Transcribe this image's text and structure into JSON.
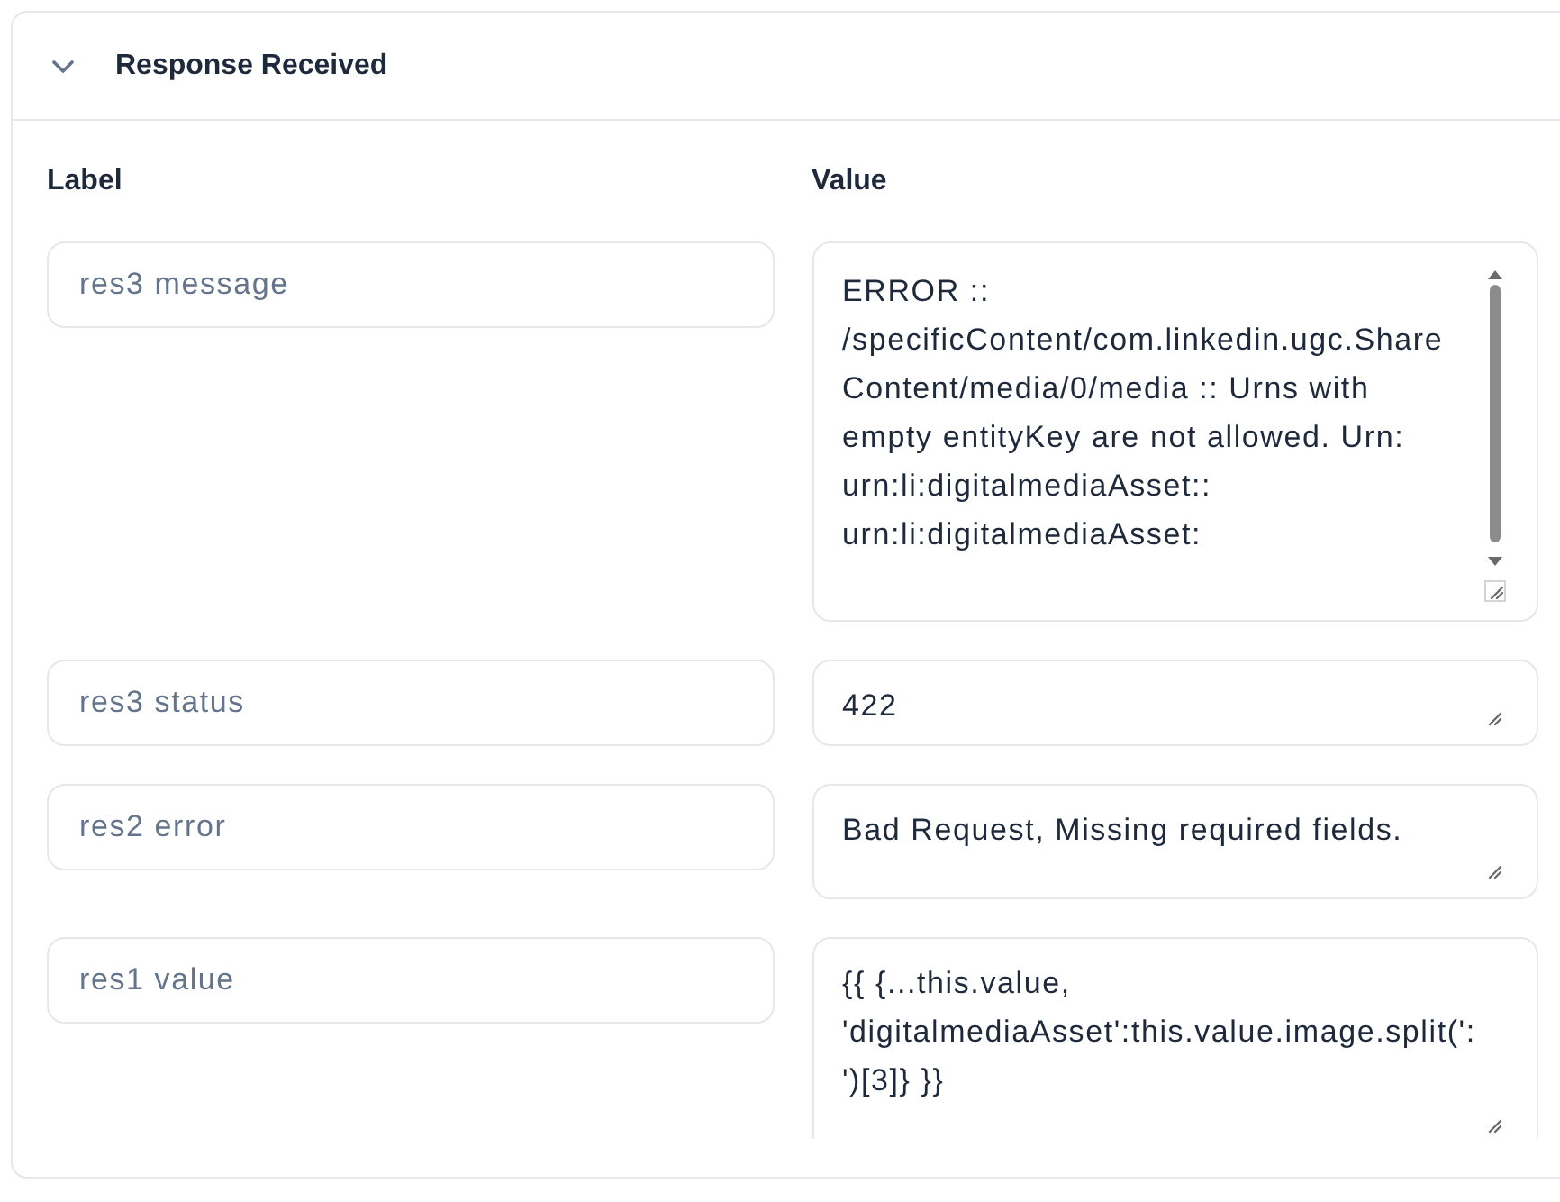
{
  "panel": {
    "title": "Response Received",
    "expanded": true,
    "columns": [
      "Label",
      "Value"
    ],
    "rows": [
      {
        "label_field": {
          "placeholder": "res3 message"
        },
        "value_field": {
          "value": "ERROR :: /specificContent/com.linkedin.ugc.ShareContent/media/0/media :: Urns with empty entityKey are not allowed. Urn: urn:li:digitalmediaAsset:: urn:li:digitalmediaAsset:",
          "scrollable": true
        }
      },
      {
        "label_field": {
          "placeholder": "res3 status"
        },
        "value_field": {
          "value": "422",
          "scrollable": false
        }
      },
      {
        "label_field": {
          "placeholder": "res2 error"
        },
        "value_field": {
          "value": "Bad Request, Missing required fields.",
          "scrollable": false
        }
      },
      {
        "label_field": {
          "placeholder": "res1 value"
        },
        "value_field": {
          "value": "{{ {...this.value, 'digitalmediaAsset':this.value.image.split(': ')[3]} }}",
          "scrollable": false
        }
      }
    ]
  }
}
